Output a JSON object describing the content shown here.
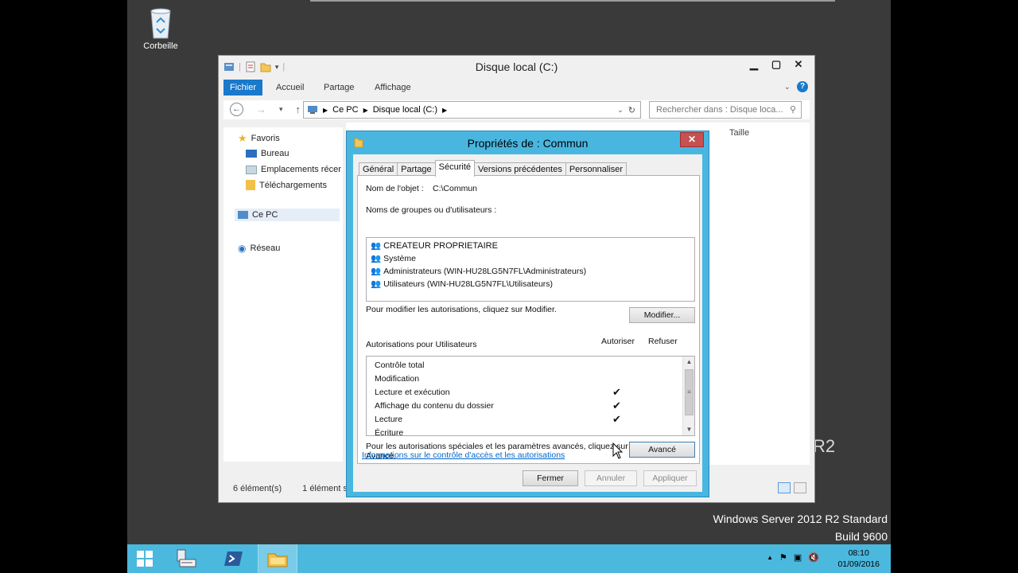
{
  "desktop": {
    "recycle_bin_label": "Corbeille",
    "watermark_line1": "Windows Server 2012 R2 Standard",
    "watermark_line2": "Build 9600",
    "r2_fragment": "R2"
  },
  "explorer": {
    "title": "Disque local (C:)",
    "ribbon_tabs": [
      "Fichier",
      "Accueil",
      "Partage",
      "Affichage"
    ],
    "breadcrumb": [
      "Ce PC",
      "Disque local (C:)"
    ],
    "search_placeholder": "Rechercher dans : Disque loca...",
    "nav": {
      "favoris": "Favoris",
      "bureau": "Bureau",
      "emplacements": "Emplacements récer",
      "telechargements": "Téléchargements",
      "ce_pc": "Ce PC",
      "reseau": "Réseau"
    },
    "columns": [
      "Taille"
    ],
    "status_count": "6 élément(s)",
    "status_selected": "1 élément se"
  },
  "dialog": {
    "title": "Propriétés de : Commun",
    "tabs": [
      "Général",
      "Partage",
      "Sécurité",
      "Versions précédentes",
      "Personnaliser"
    ],
    "active_tab": "Sécurité",
    "object_name_label": "Nom de l'objet :",
    "object_name_value": "C:\\Commun",
    "groups_label": "Noms de groupes ou d'utilisateurs :",
    "groups": [
      "CREATEUR PROPRIETAIRE",
      "Système",
      "Administrateurs (WIN-HU28LG5N7FL\\Administrateurs)",
      "Utilisateurs (WIN-HU28LG5N7FL\\Utilisateurs)"
    ],
    "modify_hint": "Pour modifier les autorisations, cliquez sur Modifier.",
    "modify_button": "Modifier...",
    "permissions_label": "Autorisations pour Utilisateurs",
    "allow_header": "Autoriser",
    "deny_header": "Refuser",
    "permissions": [
      {
        "name": "Contrôle total",
        "allow": ""
      },
      {
        "name": "Modification",
        "allow": ""
      },
      {
        "name": "Lecture et exécution",
        "allow": "✔"
      },
      {
        "name": "Affichage du contenu du dossier",
        "allow": "✔"
      },
      {
        "name": "Lecture",
        "allow": "✔"
      },
      {
        "name": "Écriture",
        "allow": ""
      }
    ],
    "advanced_hint_line1": "Pour les autorisations spéciales et les paramètres avancés, cliquez sur",
    "advanced_hint_line2": "Avancé.",
    "advanced_button": "Avancé",
    "info_link": "Informations sur le contrôle d'accès et les autorisations",
    "close_button": "Fermer",
    "cancel_button": "Annuler",
    "apply_button": "Appliquer"
  },
  "taskbar": {
    "time": "08:10",
    "date": "01/09/2016"
  }
}
